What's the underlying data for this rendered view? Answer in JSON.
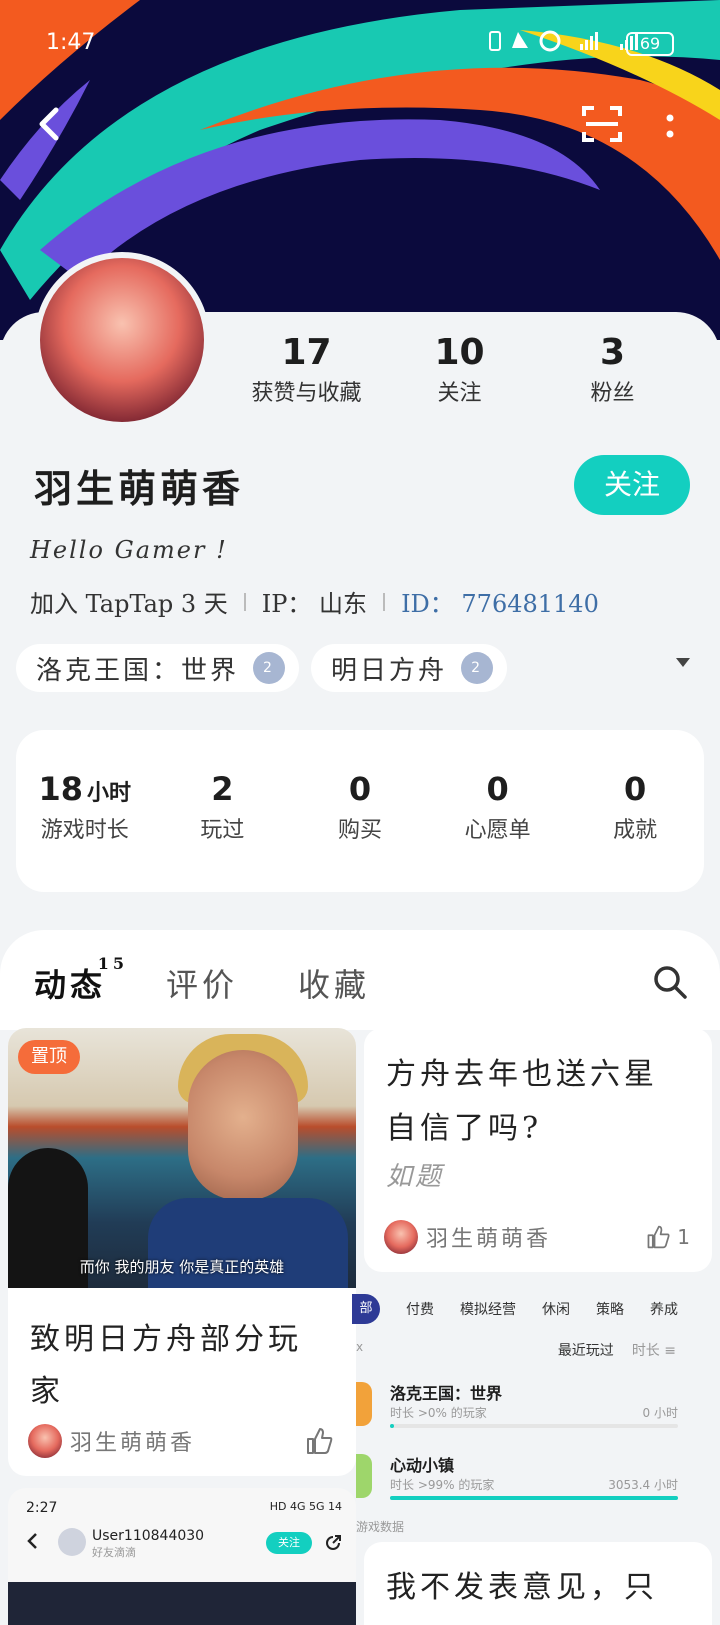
{
  "status_bar": {
    "time": "1:47",
    "battery": "69"
  },
  "profile": {
    "username": "羽生萌萌香",
    "follow_label": "关注",
    "bio": "Hello Gamer !",
    "joined": "加入 TapTap 3 天",
    "ip": "IP： 山东",
    "id": "ID： 776481140",
    "stats": [
      {
        "num": "17",
        "label": "获赞与收藏"
      },
      {
        "num": "10",
        "label": "关注"
      },
      {
        "num": "3",
        "label": "粉丝"
      }
    ],
    "games": [
      {
        "name": "洛克王国：世界",
        "badge": "2"
      },
      {
        "name": "明日方舟",
        "badge": "2"
      }
    ],
    "game_stats": [
      {
        "num": "18",
        "unit": "小时",
        "label": "游戏时长"
      },
      {
        "num": "2",
        "unit": "",
        "label": "玩过"
      },
      {
        "num": "0",
        "unit": "",
        "label": "购买"
      },
      {
        "num": "0",
        "unit": "",
        "label": "心愿单"
      },
      {
        "num": "0",
        "unit": "",
        "label": "成就"
      }
    ]
  },
  "tabs": [
    {
      "label": "动态",
      "count": "15"
    },
    {
      "label": "评价",
      "count": ""
    },
    {
      "label": "收藏",
      "count": ""
    }
  ],
  "feed": {
    "card1": {
      "pin": "置顶",
      "subtitle": "而你 我的朋友 你是真正的英雄",
      "title": "致明日方舟部分玩家",
      "author": "羽生萌萌香"
    },
    "card2": {
      "title": "方舟去年也送六星自信了吗?",
      "desc": "如题",
      "author": "羽生萌萌香",
      "likes": "1"
    },
    "card3": {
      "time": "2:27",
      "right": "HD 4G 5G 14",
      "user": "User110844030",
      "user_sub": "好友滴滴",
      "follow": "关注"
    },
    "ranking": {
      "categories": [
        "部",
        "付费",
        "模拟经营",
        "休闲",
        "策略",
        "养成"
      ],
      "sort_active": "最近玩过",
      "sort_other": "时长 ≡",
      "left_mark": "x",
      "games": [
        {
          "name": "洛克王国：世界",
          "sub": "时长 >0% 的玩家",
          "value": "0 小时",
          "pct": 0.01,
          "color": "#f2a23a"
        },
        {
          "name": "心动小镇",
          "sub": "时长 >99% 的玩家",
          "value": "3053.4 小时",
          "pct": 1.0,
          "color": "#9ed66b"
        }
      ],
      "footer": "游戏数据"
    },
    "card4": {
      "title": "我不发表意见，只"
    }
  }
}
